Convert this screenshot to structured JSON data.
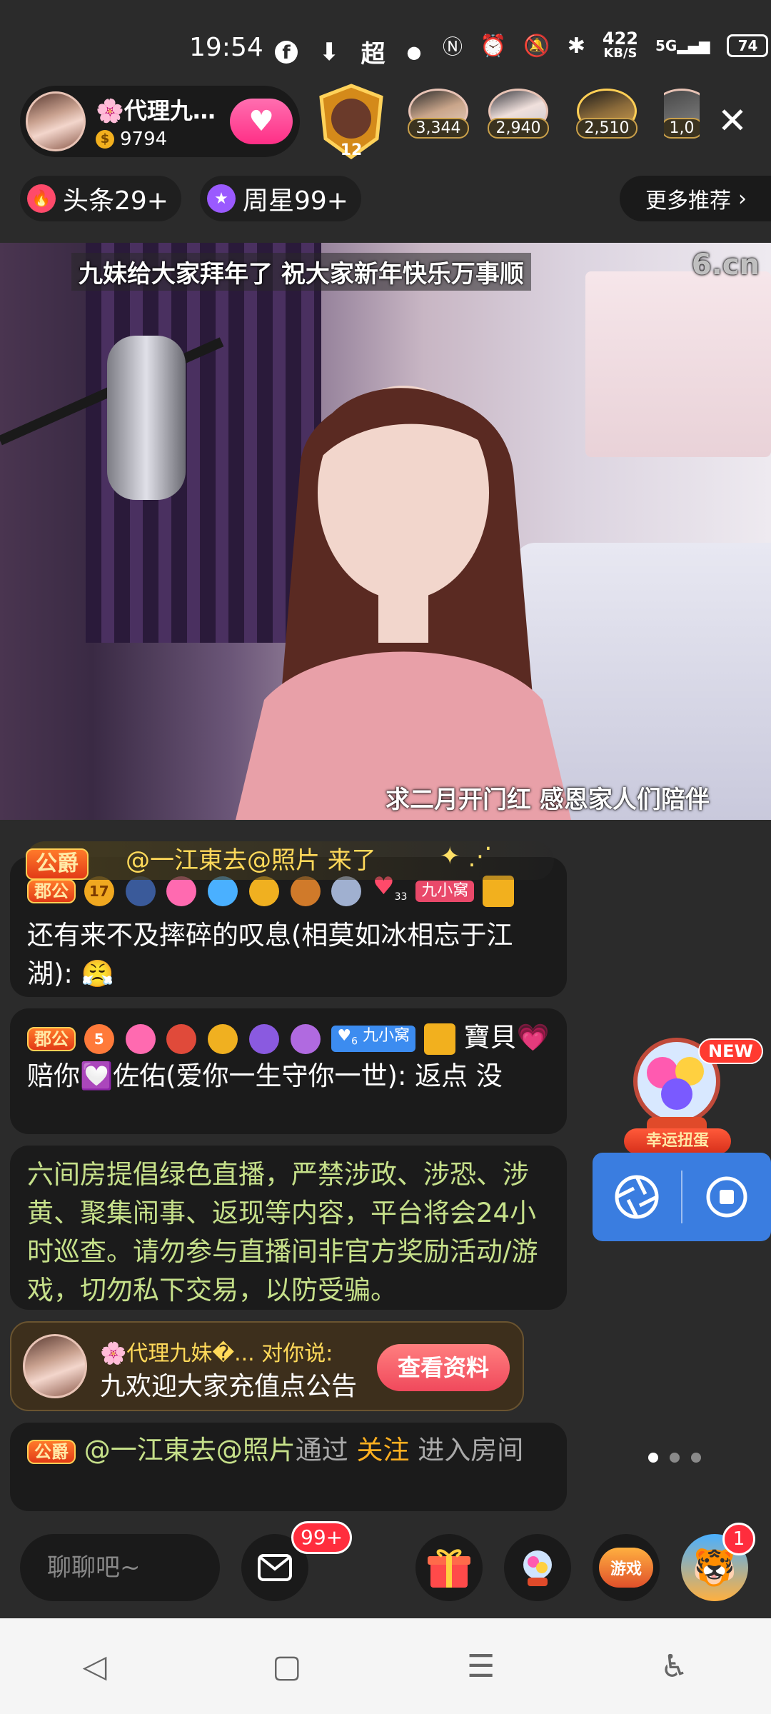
{
  "status_bar": {
    "time": "19:54",
    "app_icon_char": "超",
    "net_speed_top": "422",
    "net_speed_bottom": "KB/S",
    "signal_label": "5G",
    "battery": "74"
  },
  "host": {
    "name": "🌸代理九…",
    "fans": "9794",
    "coin_char": "$"
  },
  "guard_level": "12",
  "viewers": [
    {
      "count": "3,344"
    },
    {
      "count": "2,940"
    },
    {
      "count": "2,510"
    },
    {
      "count": "1,0"
    }
  ],
  "badges": {
    "headline": "头条29+",
    "weekly_star": "周星99+",
    "more": "更多推荐"
  },
  "video": {
    "caption_top": "九妹给大家拜年了 祝大家新年快乐万事顺",
    "caption_bottom": "求二月开门红  感恩家人们陪伴",
    "watermark": "6.cn"
  },
  "entry_banner": {
    "rank": "公爵",
    "text": "@一江東去@照片 来了"
  },
  "chat": [
    {
      "rank": "郡公",
      "level": "17",
      "heart_level": "33",
      "tag": "九小窝",
      "text": "还有来不及摔碎的叹息(相莫如冰相忘于江湖): 😤"
    },
    {
      "rank": "郡公",
      "level": "5",
      "tag": "九小窝",
      "tag_level": "6",
      "text": "寶貝💗赔你💟佐佑(爱你一生守你一世): 返点 没"
    }
  ],
  "notice": "六间房提倡绿色直播，严禁涉政、涉恐、涉黄、聚集闹事、返现等内容，平台将会24小时巡查。请勿参与直播间非官方奖励活动/游戏，切勿私下交易，以防受骗。",
  "private_msg": {
    "line1": "🌸代理九妹�... 对你说:",
    "line2": "九欢迎大家充值点公告",
    "button": "查看资料"
  },
  "follow_msg": {
    "rank": "公爵",
    "user": "@一江東去@照片",
    "mid": "通过 ",
    "action": "关注",
    "tail": " 进入房间"
  },
  "widgets": {
    "gacha_new": "NEW",
    "gacha_label": "幸运扭蛋"
  },
  "bottom": {
    "chat_placeholder": "聊聊吧~",
    "mail_badge": "99+",
    "game_label": "游戏",
    "activity_badge": "1"
  },
  "colors": {
    "background": "#2b2b2b",
    "accent_pink": "#ff2f86",
    "notice_green": "#c6e08a",
    "gold": "#ffd95a",
    "record_blue": "#3a7de0"
  }
}
